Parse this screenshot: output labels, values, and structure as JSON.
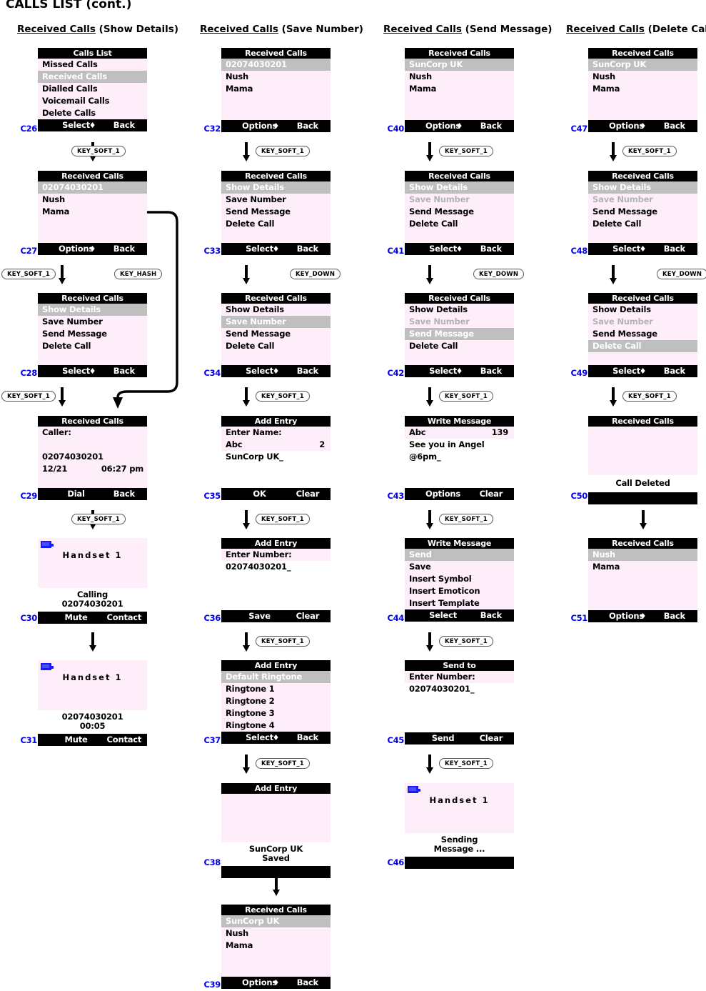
{
  "page": {
    "title": "CALLS LIST (cont.)"
  },
  "columns": [
    {
      "underlined": "Received Calls",
      "suffix": " (Show Details)"
    },
    {
      "underlined": "Received Calls",
      "suffix": " (Save Number)"
    },
    {
      "underlined": "Received Calls",
      "suffix": " (Send Message)"
    },
    {
      "underlined": "Received Calls",
      "suffix": " (Delete Call)"
    }
  ],
  "keys": {
    "soft1": "KEY_SOFT_1",
    "hash": "KEY_HASH",
    "down": "KEY_DOWN"
  },
  "labels": {
    "select": "Select",
    "back": "Back",
    "options": "Options",
    "ok": "OK",
    "clear": "Clear",
    "save": "Save",
    "dial": "Dial",
    "mute": "Mute",
    "contact": "Contact",
    "send": "Send",
    "diamond": "♦"
  },
  "screens": {
    "C26": {
      "code": "C26",
      "title": "Calls List",
      "rows": [
        "Missed Calls",
        "Received Calls",
        "Dialled Calls",
        "Voicemail Calls",
        "Delete Calls"
      ],
      "selected_index": 1,
      "soft_left": "Select",
      "soft_right": "Back",
      "has_diamond": true
    },
    "C27": {
      "code": "C27",
      "title": "Received Calls",
      "rows": [
        "02074030201",
        "Nush",
        "Mama"
      ],
      "selected_index": 0,
      "soft_left": "Options",
      "soft_right": "Back",
      "has_diamond": true
    },
    "C28": {
      "code": "C28",
      "title": "Received Calls",
      "rows": [
        "Show Details",
        "Save Number",
        "Send Message",
        "Delete Call"
      ],
      "selected_index": 0,
      "soft_left": "Select",
      "soft_right": "Back",
      "has_diamond": true
    },
    "C29": {
      "code": "C29",
      "title": "Received Calls",
      "caller_label": "Caller:",
      "number": "02074030201",
      "date": "12/21",
      "time": "06:27 pm",
      "soft_left": "Dial",
      "soft_right": "Back"
    },
    "C30": {
      "code": "C30",
      "handset": "Handset",
      "handset_number": "1",
      "notice_line1": "Calling",
      "notice_line2": "02074030201",
      "soft_left": "Mute",
      "soft_right": "Contact"
    },
    "C31": {
      "code": "C31",
      "handset": "Handset",
      "handset_number": "1",
      "notice_line1": "02074030201",
      "notice_line2": "00:05",
      "soft_left": "Mute",
      "soft_right": "Contact"
    },
    "C32": {
      "code": "C32",
      "title": "Received Calls",
      "rows": [
        "02074030201",
        "Nush",
        "Mama"
      ],
      "selected_index": 0,
      "soft_left": "Options",
      "soft_right": "Back",
      "has_diamond": true
    },
    "C33": {
      "code": "C33",
      "title": "Received Calls",
      "rows": [
        "Show Details",
        "Save Number",
        "Send Message",
        "Delete Call"
      ],
      "selected_index": 0,
      "soft_left": "Select",
      "soft_right": "Back",
      "has_diamond": true
    },
    "C34": {
      "code": "C34",
      "title": "Received Calls",
      "rows": [
        "Show Details",
        "Save Number",
        "Send Message",
        "Delete Call"
      ],
      "selected_index": 1,
      "soft_left": "Select",
      "soft_right": "Back",
      "has_diamond": true
    },
    "C35": {
      "code": "C35",
      "title": "Add Entry",
      "prompt": "Enter Name:",
      "mode": "Abc",
      "counter": "2",
      "value": "SunCorp UK_",
      "soft_left": "OK",
      "soft_right": "Clear"
    },
    "C36": {
      "code": "C36",
      "title": "Add Entry",
      "prompt": "Enter Number:",
      "value": "02074030201_",
      "soft_left": "Save",
      "soft_right": "Clear"
    },
    "C37": {
      "code": "C37",
      "title": "Add Entry",
      "rows": [
        "Default Ringtone",
        "Ringtone 1",
        "Ringtone 2",
        "Ringtone 3",
        "Ringtone 4"
      ],
      "selected_index": 0,
      "soft_left": "Select",
      "soft_right": "Back",
      "has_diamond": true
    },
    "C38": {
      "code": "C38",
      "title": "Add Entry",
      "notice_line1": "SunCorp UK",
      "notice_line2": "Saved"
    },
    "C39": {
      "code": "C39",
      "title": "Received Calls",
      "rows": [
        "SunCorp UK",
        "Nush",
        "Mama"
      ],
      "selected_index": 0,
      "soft_left": "Options",
      "soft_right": "Back",
      "has_diamond": true
    },
    "C40": {
      "code": "C40",
      "title": "Received Calls",
      "rows": [
        "SunCorp UK",
        "Nush",
        "Mama"
      ],
      "selected_index": 0,
      "soft_left": "Options",
      "soft_right": "Back",
      "has_diamond": true
    },
    "C41": {
      "code": "C41",
      "title": "Received Calls",
      "rows": [
        "Show Details",
        "Save Number",
        "Send Message",
        "Delete Call"
      ],
      "selected_index": 0,
      "disabled_index": 1,
      "soft_left": "Select",
      "soft_right": "Back",
      "has_diamond": true
    },
    "C42": {
      "code": "C42",
      "title": "Received Calls",
      "rows": [
        "Show Details",
        "Save Number",
        "Send Message",
        "Delete Call"
      ],
      "selected_index": 2,
      "disabled_index": 1,
      "soft_left": "Select",
      "soft_right": "Back",
      "has_diamond": true
    },
    "C43": {
      "code": "C43",
      "title": "Write Message",
      "mode": "Abc",
      "counter": "139",
      "line1": "See you in Angel",
      "line2": "@6pm_",
      "soft_left": "Options",
      "soft_right": "Clear"
    },
    "C44": {
      "code": "C44",
      "title": "Write Message",
      "rows": [
        "Send",
        "Save",
        "Insert Symbol",
        "Insert Emoticon",
        "Insert Template"
      ],
      "selected_index": 0,
      "soft_left": "Select",
      "soft_right": "Back",
      "has_diamond": false
    },
    "C45": {
      "code": "C45",
      "title": "Send to",
      "prompt": "Enter Number:",
      "value": "02074030201_",
      "soft_left": "Send",
      "soft_right": "Clear"
    },
    "C46": {
      "code": "C46",
      "handset": "Handset",
      "handset_number": "1",
      "notice_line1": "Sending",
      "notice_line2": "Message ..."
    },
    "C47": {
      "code": "C47",
      "title": "Received Calls",
      "rows": [
        "SunCorp UK",
        "Nush",
        "Mama"
      ],
      "selected_index": 0,
      "soft_left": "Options",
      "soft_right": "Back",
      "has_diamond": true
    },
    "C48": {
      "code": "C48",
      "title": "Received Calls",
      "rows": [
        "Show Details",
        "Save Number",
        "Send Message",
        "Delete Call"
      ],
      "selected_index": 0,
      "disabled_index": 1,
      "soft_left": "Select",
      "soft_right": "Back",
      "has_diamond": true
    },
    "C49": {
      "code": "C49",
      "title": "Received Calls",
      "rows": [
        "Show Details",
        "Save Number",
        "Send Message",
        "Delete Call"
      ],
      "selected_index": 3,
      "disabled_index": 1,
      "soft_left": "Select",
      "soft_right": "Back",
      "has_diamond": true
    },
    "C50": {
      "code": "C50",
      "title": "Received Calls",
      "notice_line1": "Call Deleted"
    },
    "C51": {
      "code": "C51",
      "title": "Received Calls",
      "rows": [
        "Nush",
        "Mama"
      ],
      "selected_index": 0,
      "soft_left": "Options",
      "soft_right": "Back",
      "has_diamond": true
    }
  }
}
